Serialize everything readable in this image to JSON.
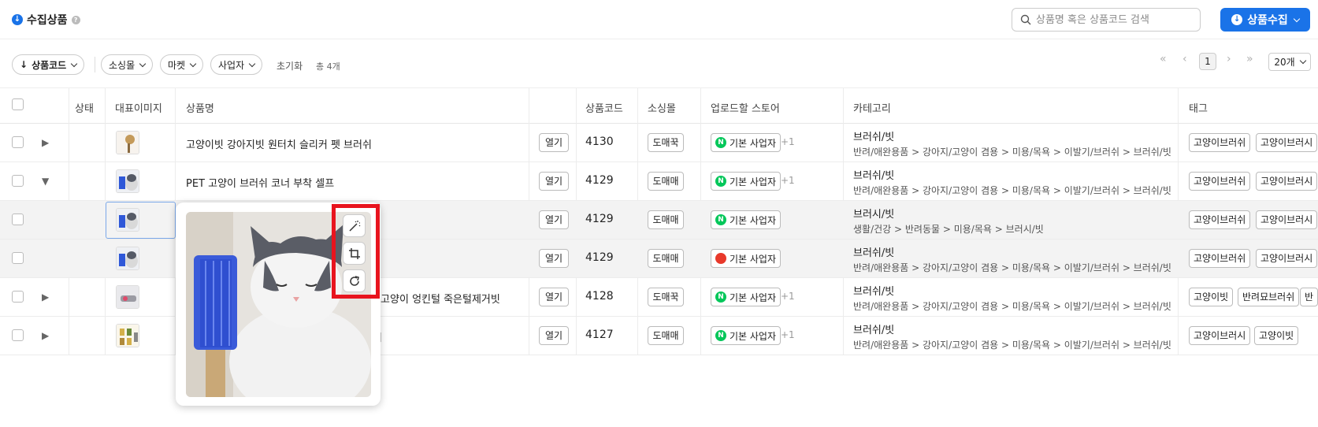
{
  "header": {
    "title": "수집상품",
    "search_placeholder": "상품명 혹은 상품코드 검색",
    "collect_label": "상품수집"
  },
  "filters": {
    "sort_label": "상품코드",
    "mall_label": "소싱몰",
    "market_label": "마켓",
    "business_label": "사업자",
    "reset_label": "초기화",
    "total_label": "총 4개"
  },
  "pagination": {
    "current_page": "1",
    "per_page": "20개",
    "first": "«",
    "prev": "‹",
    "next": "›",
    "last": "»"
  },
  "table": {
    "columns": {
      "status": "상태",
      "image": "대표이미지",
      "name": "상품명",
      "code": "상품코드",
      "mall": "소싱몰",
      "store": "업로드할 스토어",
      "category": "카테고리",
      "tags": "태그"
    },
    "open_label": "열기",
    "rows": [
      {
        "name": "고양이빗 강아지빗 원터치 슬리커 펫 브러쉬",
        "code": "4130",
        "mall": "도매꾹",
        "store": "기본 사업자",
        "store_more": "+1",
        "category_main": "브러쉬/빗",
        "category_path": "반려/애완용품 > 강아지/고양이 겸용 > 미용/목욕 > 이발기/브러쉬 > 브러쉬/빗",
        "tags": [
          "고양이브러쉬",
          "고양이브러시"
        ]
      },
      {
        "name": "PET 고양이 브러쉬 코너 부착 셀프",
        "code": "4129",
        "mall": "도매매",
        "store": "기본 사업자",
        "store_more": "+1",
        "category_main": "브러쉬/빗",
        "category_path": "반려/애완용품 > 강아지/고양이 겸용 > 미용/목욕 > 이발기/브러쉬 > 브러쉬/빗",
        "tags": [
          "고양이브러쉬",
          "고양이브러시"
        ]
      },
      {
        "name": "",
        "code": "4129",
        "mall": "도매매",
        "store": "기본 사업자",
        "store_more": "",
        "category_main": "브러시/빗",
        "category_path": "생활/건강 > 반려동물 > 미용/목욕 > 브러시/빗",
        "tags": [
          "고양이브러쉬",
          "고양이브러시"
        ]
      },
      {
        "name": "",
        "code": "4129",
        "mall": "도매매",
        "store": "기본 사업자",
        "store_more": "",
        "category_main": "브러쉬/빗",
        "category_path": "반려/애완용품 > 강아지/고양이 겸용 > 미용/목욕 > 이발기/브러쉬 > 브러쉬/빗",
        "tags": [
          "고양이브러쉬",
          "고양이브러시"
        ]
      },
      {
        "name": "아지 고양이 엉킨털 죽은털제거빗",
        "code": "4128",
        "mall": "도매꾹",
        "store": "기본 사업자",
        "store_more": "+1",
        "category_main": "브러쉬/빗",
        "category_path": "반려/애완용품 > 강아지/고양이 겸용 > 미용/목욕 > 이발기/브러쉬 > 브러쉬/빗",
        "tags": [
          "고양이빗",
          "반려묘브러쉬",
          "반"
        ]
      },
      {
        "name": "쉬",
        "code": "4127",
        "mall": "도매매",
        "store": "기본 사업자",
        "store_more": "+1",
        "category_main": "브러쉬/빗",
        "category_path": "반려/애완용품 > 강아지/고양이 겸용 > 미용/목욕 > 이발기/브러쉬 > 브러쉬/빗",
        "tags": [
          "고양이브러시",
          "고양이빗"
        ]
      }
    ]
  },
  "icons": {
    "store_naver": "N",
    "expand": "▶",
    "collapse": "▼"
  },
  "colors": {
    "accent": "#1a73e8",
    "naver": "#03c75a",
    "coupang": "#e8392b",
    "highlight_box": "#e8141e"
  }
}
